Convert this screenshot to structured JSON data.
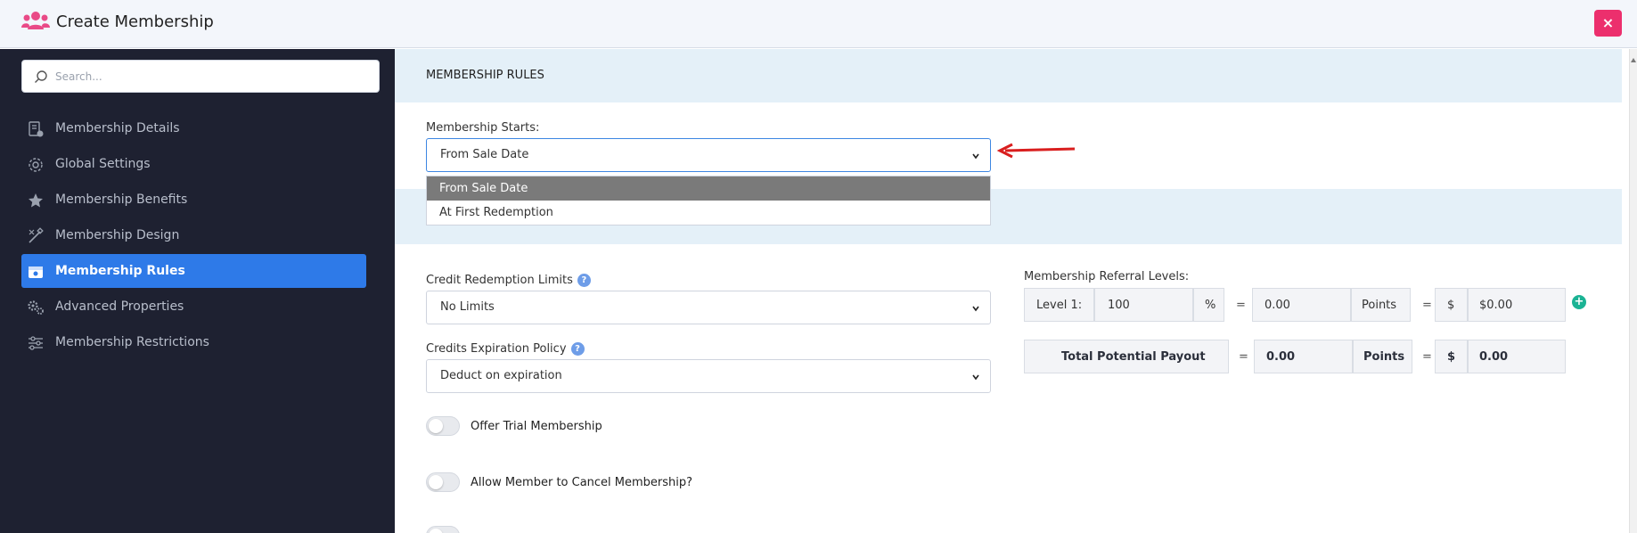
{
  "header": {
    "title": "Create Membership",
    "close_label": "×"
  },
  "search": {
    "placeholder": "Search..."
  },
  "sidebar": {
    "items": [
      {
        "label": "Membership Details",
        "icon": "document-icon"
      },
      {
        "label": "Global Settings",
        "icon": "gear-icon"
      },
      {
        "label": "Membership Benefits",
        "icon": "star-icon"
      },
      {
        "label": "Membership Design",
        "icon": "design-tools-icon"
      },
      {
        "label": "Membership Rules",
        "icon": "ticket-icon",
        "active": true
      },
      {
        "label": "Advanced Properties",
        "icon": "gears-icon"
      },
      {
        "label": "Membership Restrictions",
        "icon": "sliders-icon"
      }
    ]
  },
  "rules": {
    "section_title": "MEMBERSHIP RULES",
    "starts_label": "Membership Starts:",
    "starts_value": "From Sale Date",
    "starts_options": [
      "From Sale Date",
      "At First Redemption"
    ],
    "credit_limits_label": "Credit Redemption Limits",
    "credit_limits_value": "No Limits",
    "expiration_label": "Credits Expiration Policy",
    "expiration_value": "Deduct on expiration",
    "help_glyph": "?",
    "toggles": [
      "Offer Trial Membership",
      "Allow Member to Cancel Membership?"
    ]
  },
  "referral": {
    "label": "Membership Referral Levels:",
    "level_label": "Level 1:",
    "level_value": "100",
    "percent": "%",
    "equals": "=",
    "points_value": "0.00",
    "points_label": "Points",
    "currency": "$",
    "amount": "$0.00",
    "add_glyph": "+",
    "total_label": "Total Potential Payout",
    "total_points": "0.00",
    "total_points_label": "Points",
    "total_currency": "$",
    "total_amount": "0.00"
  },
  "colors": {
    "accent": "#2e7ae8",
    "sidebar_bg": "#1e2131",
    "close": "#ec2f6d",
    "logo": "#e94a87",
    "annotation_arrow": "#d91e1e",
    "add": "#1bb394"
  }
}
